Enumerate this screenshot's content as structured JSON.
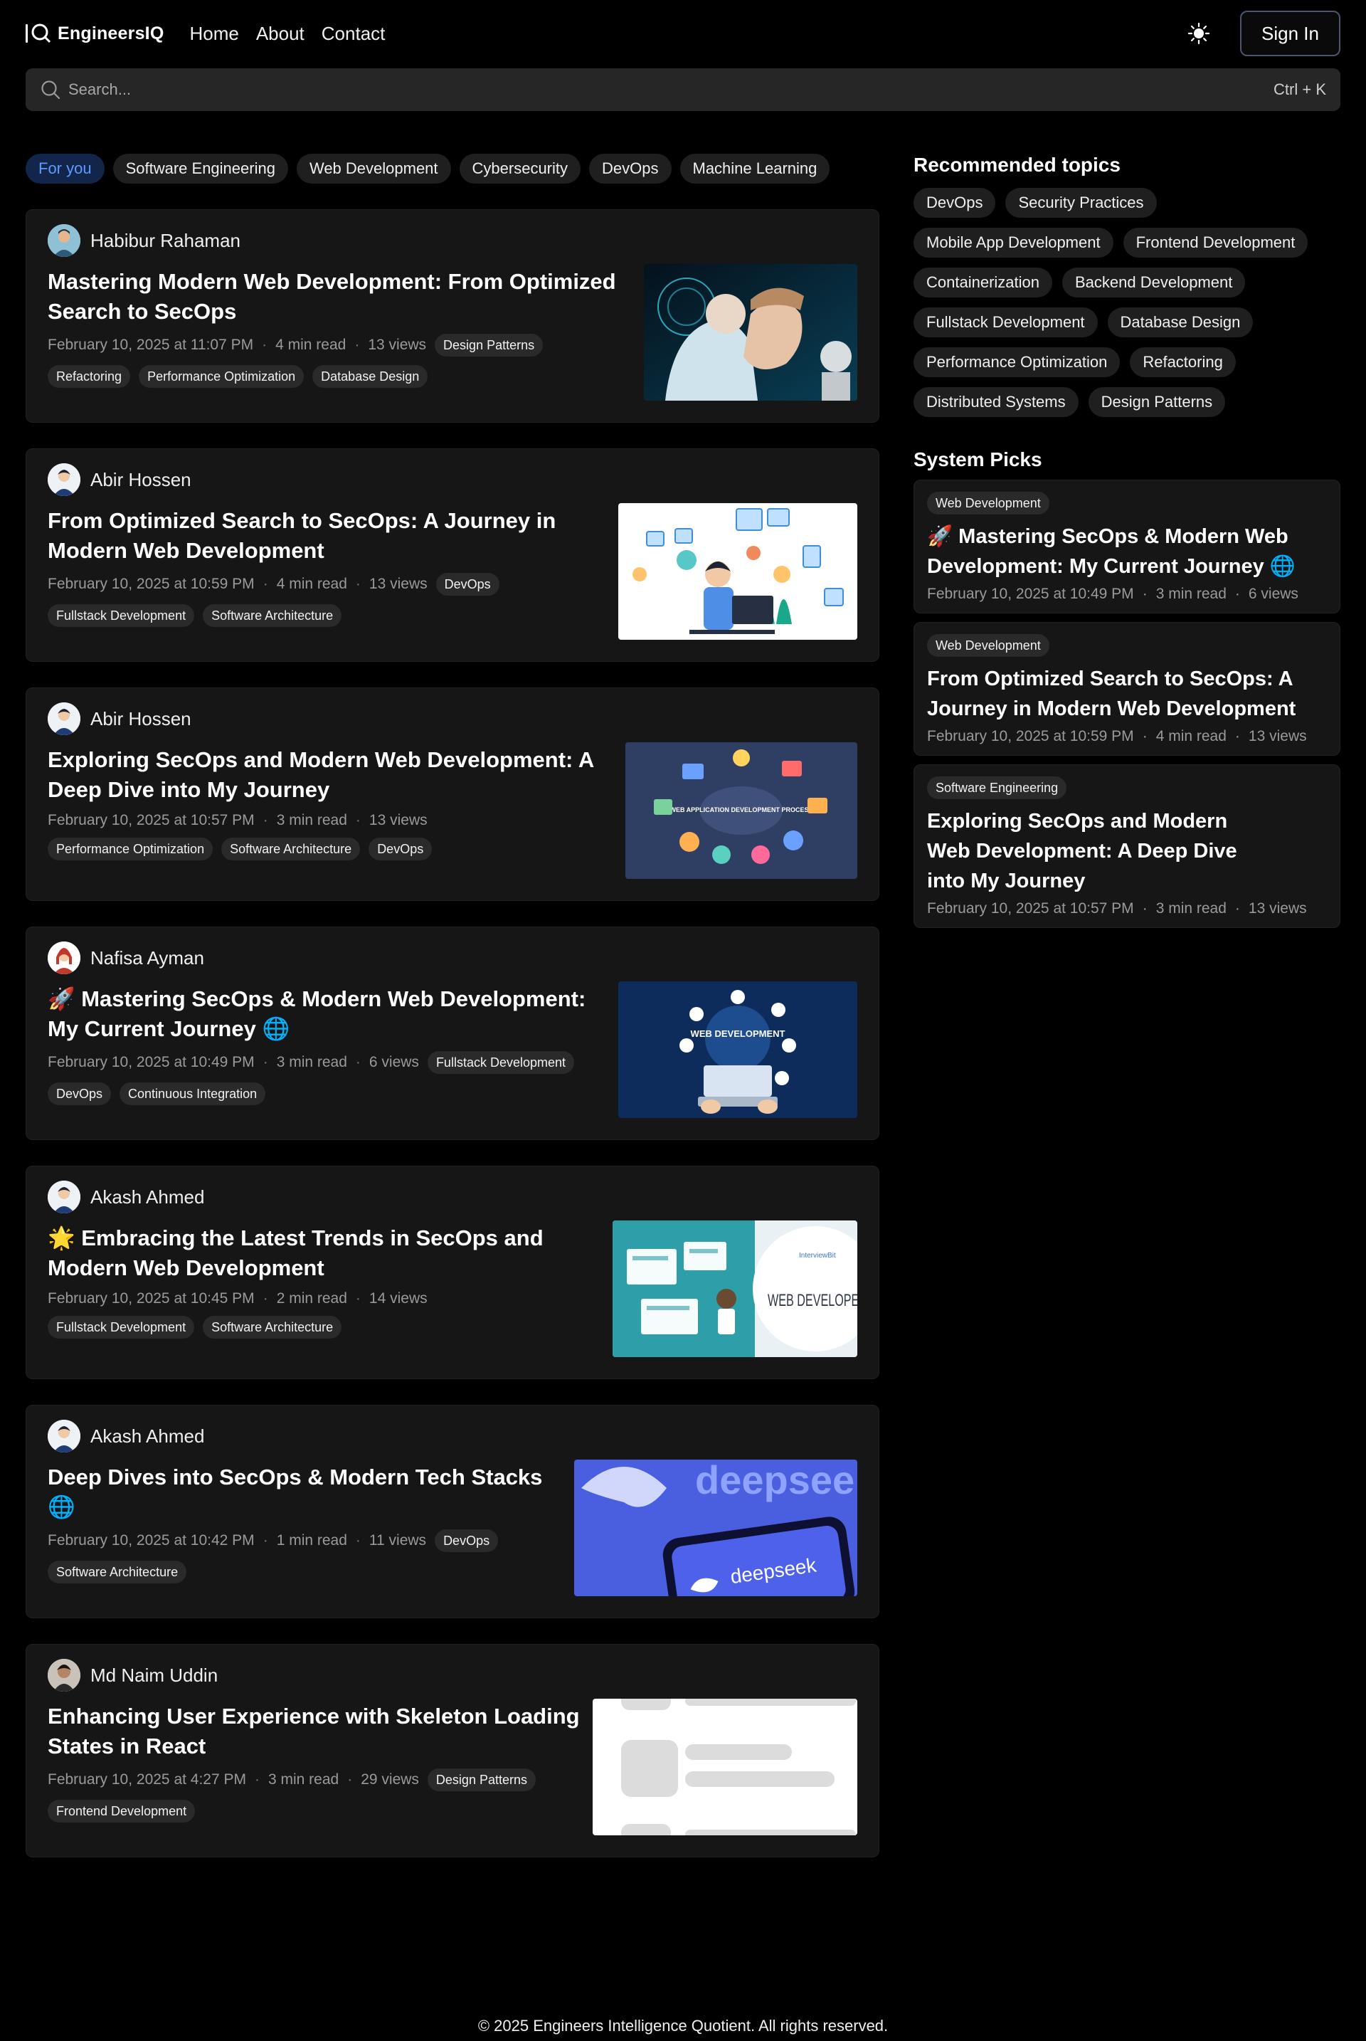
{
  "header": {
    "brand": "EngineersIQ",
    "nav": [
      "Home",
      "About",
      "Contact"
    ],
    "signin_label": "Sign In"
  },
  "search": {
    "placeholder": "Search...",
    "shortcut": "Ctrl + K"
  },
  "filters": [
    "For you",
    "Software Engineering",
    "Web Development",
    "Cybersecurity",
    "DevOps",
    "Machine Learning"
  ],
  "posts": [
    {
      "author": "Habibur Rahaman",
      "title": "Mastering Modern Web Development: From Optimized Search to SecOps",
      "date": "February 10, 2025 at 11:07 PM",
      "read": "4 min read",
      "views": "13 views",
      "tags_inline": [
        "Design Patterns"
      ],
      "tags": [
        "Refactoring",
        "Performance Optimization",
        "Database Design"
      ]
    },
    {
      "author": "Abir Hossen",
      "title": "From Optimized Search to SecOps: A Journey in Modern Web Development",
      "date": "February 10, 2025 at 10:59 PM",
      "read": "4 min read",
      "views": "13 views",
      "tags_inline": [
        "DevOps"
      ],
      "tags": [
        "Fullstack Development",
        "Software Architecture"
      ]
    },
    {
      "author": "Abir Hossen",
      "title": "Exploring SecOps and Modern Web Development: A Deep Dive into My Journey",
      "date": "February 10, 2025 at 10:57 PM",
      "read": "3 min read",
      "views": "13 views",
      "tags_inline": [],
      "tags": [
        "Performance Optimization",
        "Software Architecture",
        "DevOps"
      ]
    },
    {
      "author": "Nafisa Ayman",
      "title": "🚀 Mastering SecOps & Modern Web Development: My Current Journey 🌐",
      "date": "February 10, 2025 at 10:49 PM",
      "read": "3 min read",
      "views": "6 views",
      "tags_inline": [
        "Fullstack Development"
      ],
      "tags": [
        "DevOps",
        "Continuous Integration"
      ]
    },
    {
      "author": "Akash Ahmed",
      "title": "🌟 Embracing the Latest Trends in SecOps and Modern Web Development",
      "date": "February 10, 2025 at 10:45 PM",
      "read": "2 min read",
      "views": "14 views",
      "tags_inline": [],
      "tags": [
        "Fullstack Development",
        "Software Architecture"
      ]
    },
    {
      "author": "Akash Ahmed",
      "title": "Deep Dives into SecOps & Modern Tech Stacks 🌐",
      "date": "February 10, 2025 at 10:42 PM",
      "read": "1 min read",
      "views": "11 views",
      "tags_inline": [
        "DevOps"
      ],
      "tags": [
        "Software Architecture"
      ]
    },
    {
      "author": "Md Naim Uddin",
      "title": "Enhancing User Experience with Skeleton Loading States in React",
      "date": "February 10, 2025 at 4:27 PM",
      "read": "3 min read",
      "views": "29 views",
      "tags_inline": [
        "Design Patterns"
      ],
      "tags": [
        "Frontend Development"
      ]
    }
  ],
  "thumb_text": {
    "p3_center": "WEB APPLICATION DEVELOPMENT PROCESS",
    "p4_center": "WEB DEVELOPMENT",
    "p5_brand": "InterviewBit",
    "p5_text": "WEB DEVELOPER",
    "p6_brand": "deepseek"
  },
  "sidebar": {
    "recommended_title": "Recommended topics",
    "topics": [
      "DevOps",
      "Security Practices",
      "Mobile App Development",
      "Frontend Development",
      "Containerization",
      "Backend Development",
      "Fullstack Development",
      "Database Design",
      "Performance Optimization",
      "Refactoring",
      "Distributed Systems",
      "Design Patterns"
    ],
    "picks_title": "System Picks",
    "picks": [
      {
        "tag": "Web Development",
        "title": "🚀 Mastering SecOps & Modern Web Development: My Current Journey 🌐",
        "date": "February 10, 2025 at 10:49 PM",
        "read": "3 min read",
        "views": "6 views"
      },
      {
        "tag": "Web Development",
        "title": "From Optimized Search to SecOps: A Journey in Modern Web Development",
        "date": "February 10, 2025 at 10:59 PM",
        "read": "4 min read",
        "views": "13 views"
      },
      {
        "tag": "Software Engineering",
        "title": "Exploring SecOps and Modern Web Development: A Deep Dive into My Journey",
        "date": "February 10, 2025 at 10:57 PM",
        "read": "3 min read",
        "views": "13 views"
      }
    ]
  },
  "footer": "© 2025 Engineers Intelligence Quotient. All rights reserved."
}
